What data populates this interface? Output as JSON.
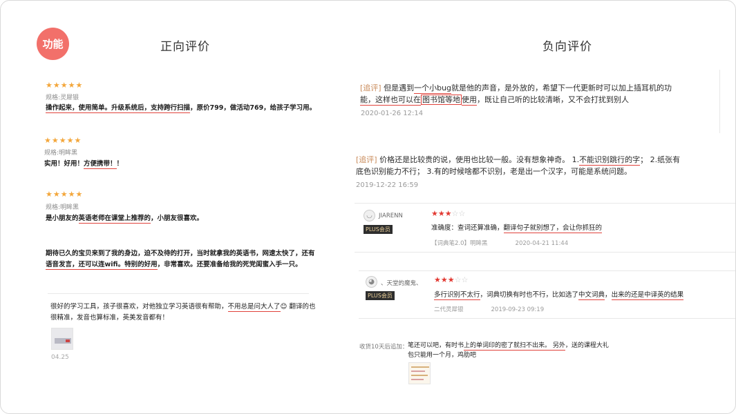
{
  "badge": {
    "label": "功能"
  },
  "headings": {
    "positive": "正向评价",
    "negative": "负向评价"
  },
  "positive": [
    {
      "stars": 5,
      "spec": "规格:灵犀银",
      "segments": [
        {
          "text": "操作起来，使用简单。升级系统后，支持跨行扫描",
          "u": true
        },
        {
          "text": "，原价799，做活动769，给孩子学习用。",
          "u": false
        }
      ]
    },
    {
      "stars": 5,
      "spec": "规格:明眸黑",
      "segments": [
        {
          "text": "实用！好用！",
          "u": false
        },
        {
          "text": "方便携带！",
          "u": true
        },
        {
          "text": "！",
          "u": false
        }
      ]
    },
    {
      "stars": 5,
      "spec": "规格:明眸黑",
      "segments": [
        {
          "text": "是小朋友的",
          "u": false
        },
        {
          "text": "英语老师在课堂上推荐的",
          "u": true
        },
        {
          "text": "，小朋友很喜欢。",
          "u": false
        }
      ]
    },
    {
      "lines": [
        [
          {
            "text": "期待已久的宝贝来到了我的身边，迫不及待的打开，当时就拿我的英语书，网速太快了，还有",
            "u": false
          }
        ],
        [
          {
            "text": "语音发言",
            "u": true
          },
          {
            "text": "，还可以连wifi。特别的好用",
            "u": true
          },
          {
            "text": "，非常喜欢。还要准备给我的死党闺蜜入手一只。",
            "u": false
          }
        ]
      ]
    },
    {
      "lines": [
        [
          {
            "text": "很好的学习工具，孩子很喜欢，对他独立学习英语很有帮助，",
            "u": false
          },
          {
            "text": "不用总是问大人了",
            "u": true
          },
          {
            "text": "😊 翻译的也",
            "u": false
          }
        ],
        [
          {
            "text": "很精准，发音也算标准，英美发音都有！",
            "u": false
          }
        ]
      ],
      "date": "04.25"
    }
  ],
  "negative": [
    {
      "tag": "[追评]",
      "line1": [
        {
          "text": " 但是遇到",
          "b": false
        },
        {
          "text": "一个小bug",
          "b": "u"
        },
        {
          "text": "就是他的声音，是外放的，希望下一代更新时可以加上插耳机的功",
          "b": false
        }
      ],
      "line2": [
        {
          "text": "能，这样也可以在",
          "b": "u"
        },
        {
          "text": "图书馆等地",
          "b": "box"
        },
        {
          "text": "使用",
          "b": "u"
        },
        {
          "text": "，既让自己听的比较清晰，又不会打扰到别人",
          "b": false
        }
      ],
      "date": "2020-01-26 12:14"
    },
    {
      "tag": "[追评]",
      "line1": [
        {
          "text": " 价格还是比较贵的说，使用也比较一般。没有想象神奇。 1.",
          "b": false
        },
        {
          "text": "不能识别跳行的字",
          "b": "u"
        },
        {
          "text": "；  2.纸张有",
          "b": false
        }
      ],
      "line2": [
        {
          "text": "底色识别能力不行；  3.有的时候啥都不识别，老是出一个汉字，可能是系统问题。",
          "b": false
        }
      ],
      "date": "2019-12-22 16:59"
    }
  ],
  "reviews": [
    {
      "username": "JIARENN",
      "plus": "PLUS会员",
      "stars": 3,
      "segments": [
        {
          "text": "准确度：查词还算准确，",
          "u": false
        },
        {
          "text": "翻译句子就别想了，会让你抓狂的",
          "u": true
        }
      ],
      "meta": [
        "【词典笔2.0】明眸黑",
        "2020-04-21 11:44"
      ]
    },
    {
      "username": "、天堂的魔鬼、",
      "plus": "PLUS会员",
      "stars": 3,
      "segments": [
        {
          "text": "多行识别不太行",
          "u": true
        },
        {
          "text": "，词典切换有时也不行，比如选了",
          "u": false
        },
        {
          "text": "中文词典",
          "u": true
        },
        {
          "text": "，",
          "u": false
        },
        {
          "text": "出来的还是中译英的结果",
          "u": true
        }
      ],
      "meta": [
        "二代灵犀银",
        "2019-09-23 09:19"
      ]
    }
  ],
  "followup": {
    "label": "收货10天后追加：",
    "line1": [
      {
        "text": "笔还可以吧，有时书",
        "u": false
      },
      {
        "text": "上的单词印的密了就扫不出来。 另外",
        "u": true
      },
      {
        "text": "，送的课程大礼",
        "u": false
      }
    ],
    "line2": [
      {
        "text": "包只能用一个月，鸡肋吧",
        "u": false
      }
    ]
  },
  "colors": {
    "accent": "#f2706a",
    "underline": "#e0413a",
    "star_positive": "#f3a63a",
    "star_negative": "#e23a33"
  }
}
